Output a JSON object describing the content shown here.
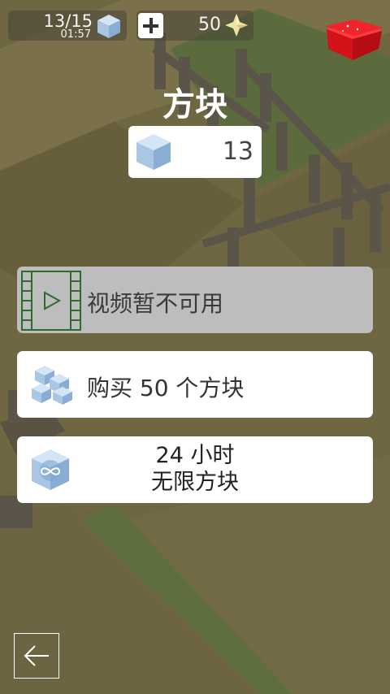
{
  "hud": {
    "cube_count": "13/15",
    "timer": "01:57",
    "star_count": "50"
  },
  "panel": {
    "title": "方块",
    "cube_value": "13"
  },
  "options": {
    "video_label": "视频暂不可用",
    "buy_label": "购买 50 个方块",
    "infinite_line1": "24 小时",
    "infinite_line2": "无限方块"
  },
  "colors": {
    "background_field": "#6f6642",
    "button_disabled": "#bdbdbd",
    "button_active": "#ffffff",
    "gift_red": "#e8141c",
    "cube_blue": "#aac8e6",
    "star_gold": "#efe2a4"
  },
  "icons": {
    "cube": "cube-icon",
    "star": "star-icon",
    "gift": "gift-box-icon",
    "film": "film-play-icon",
    "cubes": "cubes-stack-icon",
    "infinite": "infinite-cube-icon",
    "back": "back-arrow-icon",
    "plus": "plus-icon"
  }
}
